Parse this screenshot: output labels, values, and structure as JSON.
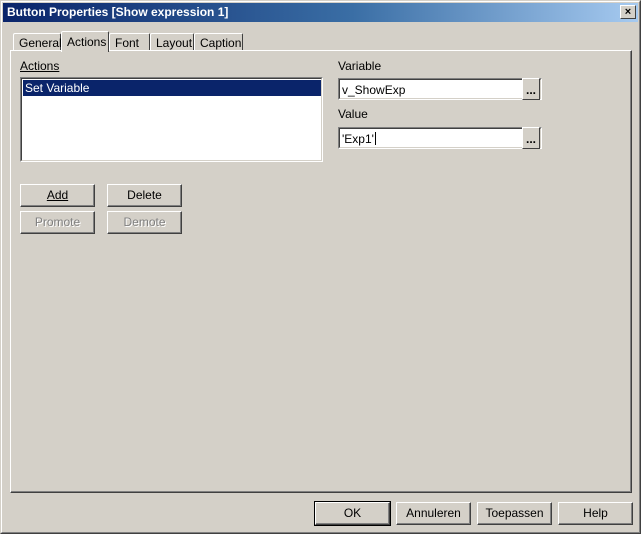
{
  "window": {
    "title": "Button Properties [Show expression 1]"
  },
  "tabs": [
    {
      "label": "General"
    },
    {
      "label": "Actions"
    },
    {
      "label": "Font"
    },
    {
      "label": "Layout"
    },
    {
      "label": "Caption"
    }
  ],
  "actions": {
    "label": "Actions",
    "items": [
      {
        "label": "Set Variable",
        "selected": true
      }
    ]
  },
  "variable": {
    "label": "Variable",
    "value": "v_ShowExp",
    "button_label": "..."
  },
  "value": {
    "label": "Value",
    "value": "'Exp1'",
    "button_label": "..."
  },
  "action_buttons": {
    "add": "Add",
    "delete": "Delete",
    "promote": "Promote",
    "demote": "Demote"
  },
  "footer": {
    "ok": "OK",
    "cancel": "Annuleren",
    "apply": "Toepassen",
    "help": "Help"
  },
  "close_icon": "×",
  "colors": {
    "selection": "#0a246a",
    "titlebar_start": "#0a246a",
    "titlebar_end": "#a6caf0",
    "face": "#d4d0c8"
  }
}
